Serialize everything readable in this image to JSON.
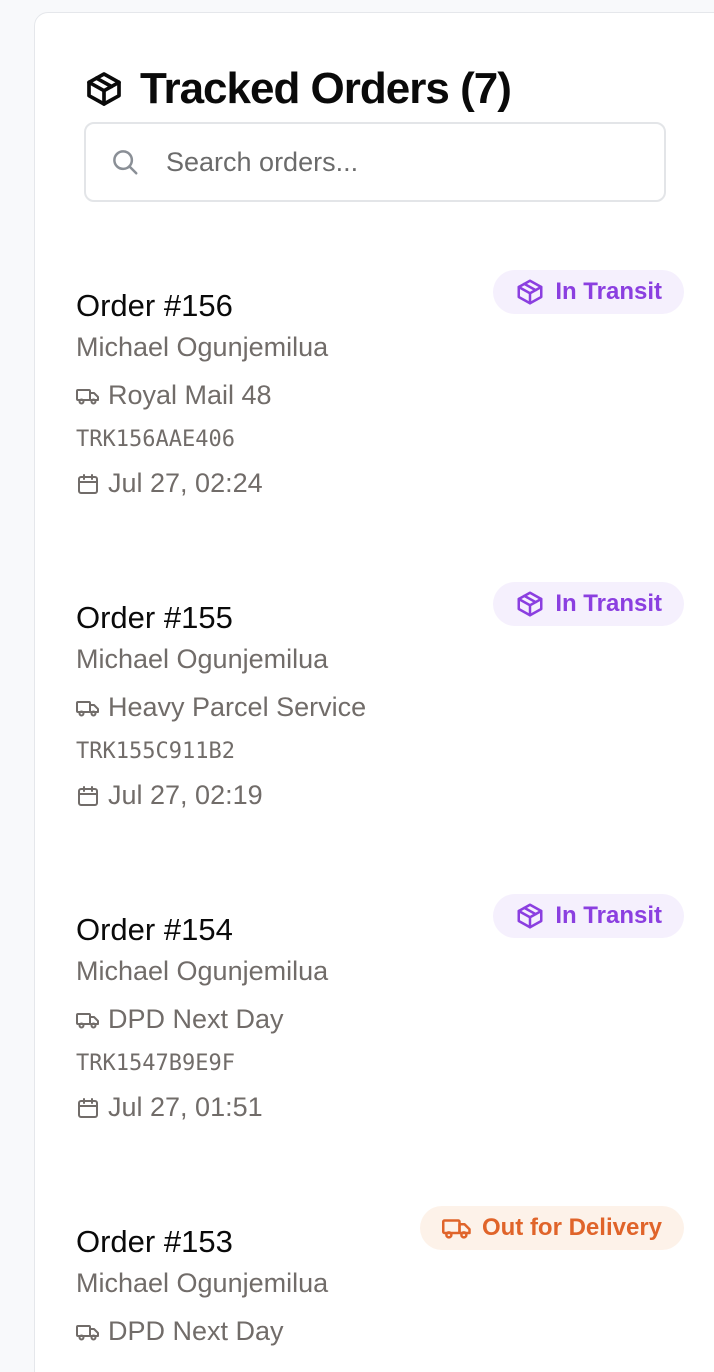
{
  "header": {
    "title": "Tracked Orders (7)",
    "icon": "package-icon"
  },
  "search": {
    "placeholder": "Search orders...",
    "value": ""
  },
  "orders": [
    {
      "title": "Order #156",
      "status": "In Transit",
      "status_type": "transit",
      "customer": "Michael Ogunjemilua",
      "carrier": "Royal Mail 48",
      "tracking": "TRK156AAE406",
      "date": "Jul 27, 02:24"
    },
    {
      "title": "Order #155",
      "status": "In Transit",
      "status_type": "transit",
      "customer": "Michael Ogunjemilua",
      "carrier": "Heavy Parcel Service",
      "tracking": "TRK155C911B2",
      "date": "Jul 27, 02:19"
    },
    {
      "title": "Order #154",
      "status": "In Transit",
      "status_type": "transit",
      "customer": "Michael Ogunjemilua",
      "carrier": "DPD Next Day",
      "tracking": "TRK1547B9E9F",
      "date": "Jul 27, 01:51"
    },
    {
      "title": "Order #153",
      "status": "Out for Delivery",
      "status_type": "delivery",
      "customer": "Michael Ogunjemilua",
      "carrier": "DPD Next Day"
    }
  ],
  "colors": {
    "transit": "#8b3fe0",
    "delivery": "#e0642a",
    "muted_text": "#716c69"
  }
}
